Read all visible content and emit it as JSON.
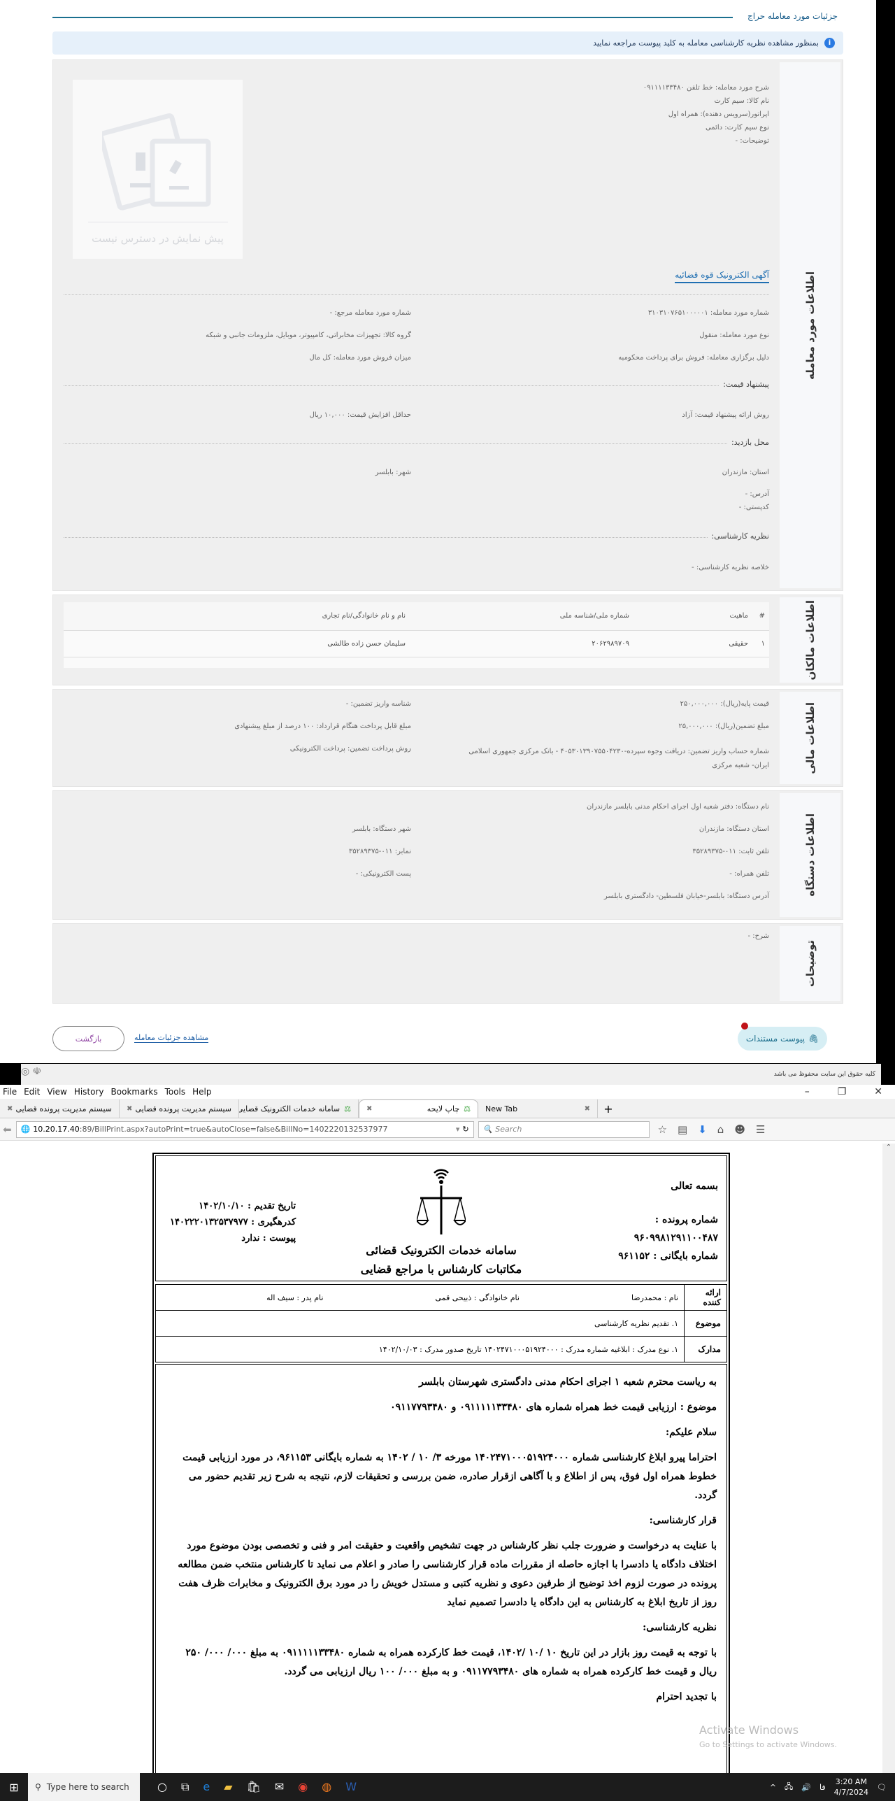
{
  "page": {
    "title": "جزئیات مورد معامله حراج",
    "banner": "بمنظور مشاهده نظریه کارشناسی معامله به کلید پیوست مراجعه نمایید"
  },
  "deal": {
    "side_label": "اطلاعات مورد معامله",
    "preview_unavailable": "پیش نمایش در دسترس نیست",
    "desc_lines": [
      "شرح مورد معامله: خط تلفن ۰۹۱۱۱۱۳۳۴۸۰",
      "نام کالا: سیم کارت",
      "اپراتور(سرویس دهنده): همراه اول",
      "نوع سیم کارت: دائمی",
      "توضیحات: -"
    ],
    "ad_link": "آگهی الکترونیک قوه قضائیه",
    "deal_number": "شماره مورد معامله: ۳۱۰۳۱۰۷۶۵۱۰۰۰۰۰۱",
    "ref_number": "شماره مورد معامله مرجع: -",
    "deal_type": "نوع مورد معامله: منقول",
    "goods_group": "گروه کالا: تجهیزات مخابراتی، کامپیوتر، موبایل، ملزومات جانبی و شبکه",
    "reason": "دلیل برگزاری معامله: فروش برای پرداخت محکومبه",
    "sale_amount": "میزان فروش مورد معامله: کل مال",
    "bid_heading": "پیشنهاد قیمت:",
    "bid_method": "روش ارائه پیشنهاد قیمت: آزاد",
    "min_increase": "حداقل افزایش قیمت: ۱۰,۰۰۰ ریال",
    "visit_heading": "محل بازدید:",
    "province": "استان: مازندران",
    "city": "شهر: بابلسر",
    "address": "آدرس: -",
    "postal": "کدپستی: -",
    "opinion_heading": "نظریه کارشناسی:",
    "opinion_summary": "خلاصه نظریه کارشناسی: -"
  },
  "owners": {
    "side_label": "اطلاعات مالکان",
    "columns": [
      "#",
      "ماهیت",
      "شماره ملی/شناسه ملی",
      "نام و نام خانوادگی/نام تجاری"
    ],
    "rows": [
      {
        "idx": "۱",
        "type": "حقیقی",
        "national_id": "۲۰۶۲۹۸۹۷۰۹",
        "name": "سلیمان حسن زاده طالشی"
      }
    ]
  },
  "finance": {
    "side_label": "اطلاعات مالی",
    "base_price": "قیمت پایه(ریال): ۲۵۰,۰۰۰,۰۰۰",
    "deposit_id": "شناسه واریز تضمین: -",
    "guarantee": "مبلغ تضمین(ریال): ۲۵,۰۰۰,۰۰۰",
    "payable": "مبلغ قابل پرداخت هنگام قرارداد: ۱۰۰ درصد از مبلغ پیشنهادی",
    "account": "شماره حساب واریز تضمین: دریافت وجوه سپرده-۴۰۵۳۰۱۳۹۰۷۵۵۰۴۲۳۰ - بانک مرکزی جمهوری اسلامی ایران- شعبه مرکزی",
    "pay_method": "روش پرداخت تضمین: پرداخت الکترونیکی"
  },
  "agency": {
    "side_label": "اطلاعات دستگاه",
    "name": "نام دستگاه: دفتر شعبه اول اجرای احکام مدنی بابلسر مازندران",
    "province": "استان دستگاه: مازندران",
    "city": "شهر دستگاه: بابلسر",
    "phone": "تلفن ثابت: ۰۱۱-۳۵۲۸۹۳۷۵",
    "fax": "نمابر: ۰۱۱-۳۵۲۸۹۳۷۵",
    "mobile": "تلفن همراه: -",
    "email": "پست الکترونیکی: -",
    "address": "آدرس دستگاه: بابلسر-خیابان فلسطین- دادگستری بابلسر"
  },
  "notes": {
    "side_label": "توضیحات",
    "desc": "شرح: -"
  },
  "actions": {
    "attachments": "پیوست مستندات",
    "attachments_badge": "!",
    "view_details": "مشاهده جزئیات معامله",
    "back": "بازگشت"
  },
  "footer": {
    "copyright": "کلیه حقوق این سایت محفوظ می باشد"
  },
  "browser": {
    "menu": [
      "File",
      "Edit",
      "View",
      "History",
      "Bookmarks",
      "Tools",
      "Help"
    ],
    "tabs": [
      {
        "label": "سیستم مدیریت پرونده قضایی"
      },
      {
        "label": "سیستم مدیریت پرونده قضایی"
      },
      {
        "label": "سامانه خدمات الکترونیک قضایی"
      },
      {
        "label": "چاپ لایحه",
        "active": true
      },
      {
        "label": "New Tab"
      }
    ],
    "url_host": "10.20.17.40",
    "url_rest": ":89/BillPrint.aspx?autoPrint=true&autoClose=false&BillNo=1402220132537977",
    "search_placeholder": "Search"
  },
  "document": {
    "bismillah": "بسمه تعالی",
    "case_label": "شماره پرونده :",
    "case_number": "۹۶۰۹۹۸۱۲۹۱۱۰۰۴۸۷",
    "archive": "شماره بایگانی : ۹۶۱۱۵۲",
    "submit_date": "تاریخ تقدیم : ۱۴۰۲/۱۰/۱۰",
    "tracking": "کدرهگیری : ۱۴۰۲۲۲۰۱۳۲۵۳۷۹۷۷",
    "attachment": "پیوست : ندارد",
    "system_title": "سامانه خدمات الکترونیک قضائی",
    "subtitle": "مکاتبات کارشناس با مراجع قضایی",
    "presenter_label": "ارائه کننده",
    "first_name": "نام : محمدرضا",
    "last_name": "نام خانوادگی : ذبیحی قمی",
    "father": "نام پدر : سیف اله",
    "subject_label": "موضوع",
    "subject": "۱. تقدیم نظریه کارشناسی",
    "docs_label": "مدارک",
    "docs": "۱. نوع مدرک : ابلاغیه   شماره مدرک : ۱۴۰۲۴۷۱۰۰۰۵۱۹۲۴۰۰۰   تاریخ صدور مدرک : ۱۴۰۲/۱۰/۰۳",
    "paragraphs": [
      "به ریاست محترم شعبه ۱ اجرای احکام مدنی دادگستری شهرستان بابلسر",
      "موضوع : ارزیابی قیمت خط همراه شماره های ۰۹۱۱۱۱۱۳۳۴۸۰ و ۰۹۱۱۷۷۹۳۴۸۰",
      "سلام علیکم:",
      "احتراما پیرو ابلاغ کارشناسی شماره ۱۴۰۲۴۷۱۰۰۰۵۱۹۲۴۰۰۰ مورخه ۳/ ۱۰ / ۱۴۰۲ به شماره بایگانی ۹۶۱۱۵۳، در مورد ارزیابی قیمت خطوط همراه اول فوق، پس از اطلاع و با آگاهی ازقرار صادره، ضمن بررسی و تحقیقات لازم، نتیجه به شرح زیر تقدیم حضور می گردد.",
      "قرار کارشناسی:",
      "با عنایت به درخواست و ضرورت جلب نظر کارشناس در جهت تشخیص واقعیت و حقیقت امر و فنی و تخصصی بودن موضوع مورد اختلاف دادگاه یا دادسرا با اجازه حاصله از مقررات ماده قرار کارشناسی را صادر و اعلام می نماید تا کارشناس منتخب ضمن مطالعه پرونده در صورت لزوم اخذ توضیح از طرفین دعوی و نظریه کتبی و مستدل خویش را در مورد برق الکترونیک و مخابرات ظرف هفت روز از تاریخ ابلاغ به کارشناس به این دادگاه یا دادسرا تصمیم نماید",
      "نظریه کارشناسی:",
      "با توجه به قیمت روز بازار در این تاریخ ۱۰ /۱۰ /۱۴۰۲، قیمت خط  کارکرده همراه به شماره ۰۹۱۱۱۱۱۳۳۴۸۰  به مبلغ ۰۰۰/ ۰۰۰/ ۲۵۰ ریال و قیمت خط  کارکرده همراه به شماره های ۰۹۱۱۷۷۹۳۴۸۰ و به مبلغ ۰۰۰/ ۱۰۰ ریال ارزیابی می گردد.",
      "با تجدید احترام"
    ]
  },
  "watermark": {
    "line1": "Activate Windows",
    "line2": "Go to Settings to activate Windows."
  },
  "taskbar": {
    "search_placeholder": "Type here to search",
    "time": "3:20 AM",
    "date": "4/7/2024",
    "lang": "فا"
  }
}
